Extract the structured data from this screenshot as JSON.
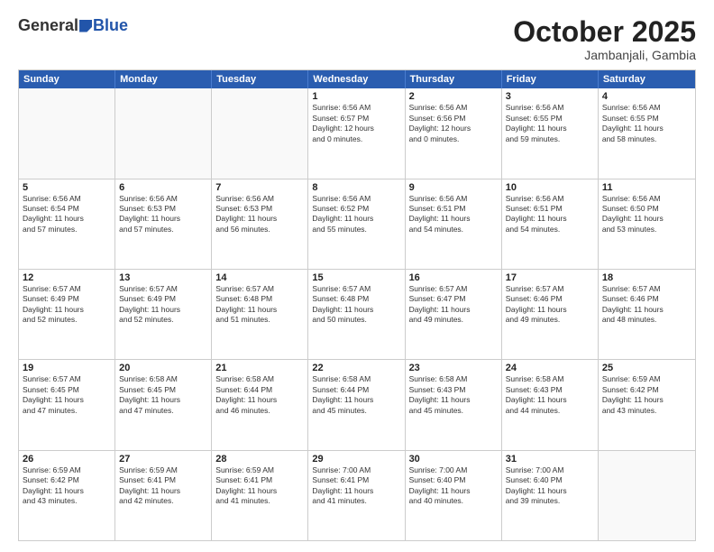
{
  "header": {
    "logo": {
      "general": "General",
      "blue": "Blue"
    },
    "title": "October 2025",
    "location": "Jambanjali, Gambia"
  },
  "weekdays": [
    "Sunday",
    "Monday",
    "Tuesday",
    "Wednesday",
    "Thursday",
    "Friday",
    "Saturday"
  ],
  "rows": [
    [
      {
        "day": "",
        "info": ""
      },
      {
        "day": "",
        "info": ""
      },
      {
        "day": "",
        "info": ""
      },
      {
        "day": "1",
        "info": "Sunrise: 6:56 AM\nSunset: 6:57 PM\nDaylight: 12 hours\nand 0 minutes."
      },
      {
        "day": "2",
        "info": "Sunrise: 6:56 AM\nSunset: 6:56 PM\nDaylight: 12 hours\nand 0 minutes."
      },
      {
        "day": "3",
        "info": "Sunrise: 6:56 AM\nSunset: 6:55 PM\nDaylight: 11 hours\nand 59 minutes."
      },
      {
        "day": "4",
        "info": "Sunrise: 6:56 AM\nSunset: 6:55 PM\nDaylight: 11 hours\nand 58 minutes."
      }
    ],
    [
      {
        "day": "5",
        "info": "Sunrise: 6:56 AM\nSunset: 6:54 PM\nDaylight: 11 hours\nand 57 minutes."
      },
      {
        "day": "6",
        "info": "Sunrise: 6:56 AM\nSunset: 6:53 PM\nDaylight: 11 hours\nand 57 minutes."
      },
      {
        "day": "7",
        "info": "Sunrise: 6:56 AM\nSunset: 6:53 PM\nDaylight: 11 hours\nand 56 minutes."
      },
      {
        "day": "8",
        "info": "Sunrise: 6:56 AM\nSunset: 6:52 PM\nDaylight: 11 hours\nand 55 minutes."
      },
      {
        "day": "9",
        "info": "Sunrise: 6:56 AM\nSunset: 6:51 PM\nDaylight: 11 hours\nand 54 minutes."
      },
      {
        "day": "10",
        "info": "Sunrise: 6:56 AM\nSunset: 6:51 PM\nDaylight: 11 hours\nand 54 minutes."
      },
      {
        "day": "11",
        "info": "Sunrise: 6:56 AM\nSunset: 6:50 PM\nDaylight: 11 hours\nand 53 minutes."
      }
    ],
    [
      {
        "day": "12",
        "info": "Sunrise: 6:57 AM\nSunset: 6:49 PM\nDaylight: 11 hours\nand 52 minutes."
      },
      {
        "day": "13",
        "info": "Sunrise: 6:57 AM\nSunset: 6:49 PM\nDaylight: 11 hours\nand 52 minutes."
      },
      {
        "day": "14",
        "info": "Sunrise: 6:57 AM\nSunset: 6:48 PM\nDaylight: 11 hours\nand 51 minutes."
      },
      {
        "day": "15",
        "info": "Sunrise: 6:57 AM\nSunset: 6:48 PM\nDaylight: 11 hours\nand 50 minutes."
      },
      {
        "day": "16",
        "info": "Sunrise: 6:57 AM\nSunset: 6:47 PM\nDaylight: 11 hours\nand 49 minutes."
      },
      {
        "day": "17",
        "info": "Sunrise: 6:57 AM\nSunset: 6:46 PM\nDaylight: 11 hours\nand 49 minutes."
      },
      {
        "day": "18",
        "info": "Sunrise: 6:57 AM\nSunset: 6:46 PM\nDaylight: 11 hours\nand 48 minutes."
      }
    ],
    [
      {
        "day": "19",
        "info": "Sunrise: 6:57 AM\nSunset: 6:45 PM\nDaylight: 11 hours\nand 47 minutes."
      },
      {
        "day": "20",
        "info": "Sunrise: 6:58 AM\nSunset: 6:45 PM\nDaylight: 11 hours\nand 47 minutes."
      },
      {
        "day": "21",
        "info": "Sunrise: 6:58 AM\nSunset: 6:44 PM\nDaylight: 11 hours\nand 46 minutes."
      },
      {
        "day": "22",
        "info": "Sunrise: 6:58 AM\nSunset: 6:44 PM\nDaylight: 11 hours\nand 45 minutes."
      },
      {
        "day": "23",
        "info": "Sunrise: 6:58 AM\nSunset: 6:43 PM\nDaylight: 11 hours\nand 45 minutes."
      },
      {
        "day": "24",
        "info": "Sunrise: 6:58 AM\nSunset: 6:43 PM\nDaylight: 11 hours\nand 44 minutes."
      },
      {
        "day": "25",
        "info": "Sunrise: 6:59 AM\nSunset: 6:42 PM\nDaylight: 11 hours\nand 43 minutes."
      }
    ],
    [
      {
        "day": "26",
        "info": "Sunrise: 6:59 AM\nSunset: 6:42 PM\nDaylight: 11 hours\nand 43 minutes."
      },
      {
        "day": "27",
        "info": "Sunrise: 6:59 AM\nSunset: 6:41 PM\nDaylight: 11 hours\nand 42 minutes."
      },
      {
        "day": "28",
        "info": "Sunrise: 6:59 AM\nSunset: 6:41 PM\nDaylight: 11 hours\nand 41 minutes."
      },
      {
        "day": "29",
        "info": "Sunrise: 7:00 AM\nSunset: 6:41 PM\nDaylight: 11 hours\nand 41 minutes."
      },
      {
        "day": "30",
        "info": "Sunrise: 7:00 AM\nSunset: 6:40 PM\nDaylight: 11 hours\nand 40 minutes."
      },
      {
        "day": "31",
        "info": "Sunrise: 7:00 AM\nSunset: 6:40 PM\nDaylight: 11 hours\nand 39 minutes."
      },
      {
        "day": "",
        "info": ""
      }
    ]
  ]
}
